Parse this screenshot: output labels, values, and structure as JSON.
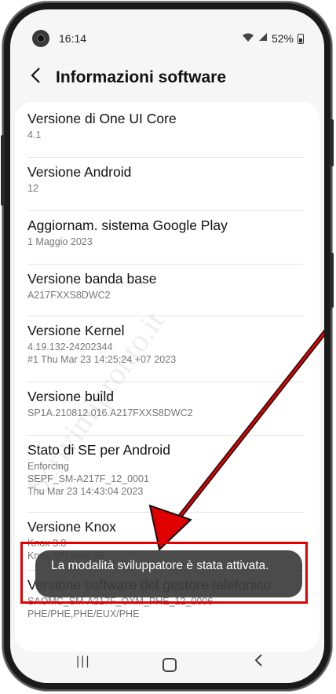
{
  "status": {
    "time": "16:14",
    "battery": "52%",
    "icons": [
      "wifi-icon",
      "signal-icon",
      "battery-icon"
    ]
  },
  "header": {
    "title": "Informazioni software"
  },
  "items": [
    {
      "title": "Versione di One UI Core",
      "subtitle": [
        "4.1"
      ]
    },
    {
      "title": "Versione Android",
      "subtitle": [
        "12"
      ]
    },
    {
      "title": "Aggiornam. sistema Google Play",
      "subtitle": [
        "1 Maggio 2023"
      ]
    },
    {
      "title": "Versione banda base",
      "subtitle": [
        "A217FXXS8DWC2"
      ]
    },
    {
      "title": "Versione Kernel",
      "subtitle": [
        "4.19.132-24202344",
        "#1 Thu Mar 23 14:25:24 +07 2023"
      ]
    },
    {
      "title": "Versione build",
      "subtitle": [
        "SP1A.210812.016.A217FXXS8DWC2"
      ]
    },
    {
      "title": "Stato di SE per Android",
      "subtitle": [
        "Enforcing",
        "SEPF_SM-A217F_12_0001",
        "Thu Mar 23 14:43:04 2023"
      ]
    },
    {
      "title": "Versione Knox",
      "subtitle": [
        "Knox 3.8",
        "Knox API level 35"
      ]
    },
    {
      "title": "Versione software del gestore telefonico",
      "subtitle": [
        "SAOMC_SM-A217F_OXM_PHE_12_0006",
        "PHE/PHE,PHE/EUX/PHE"
      ]
    }
  ],
  "toast": {
    "text": "La modalità sviluppatore è stata attivata."
  },
  "watermark": "Scrivimipronto.it",
  "colors": {
    "accent_red": "#e00000",
    "toast_bg": "#3c3c3c"
  }
}
